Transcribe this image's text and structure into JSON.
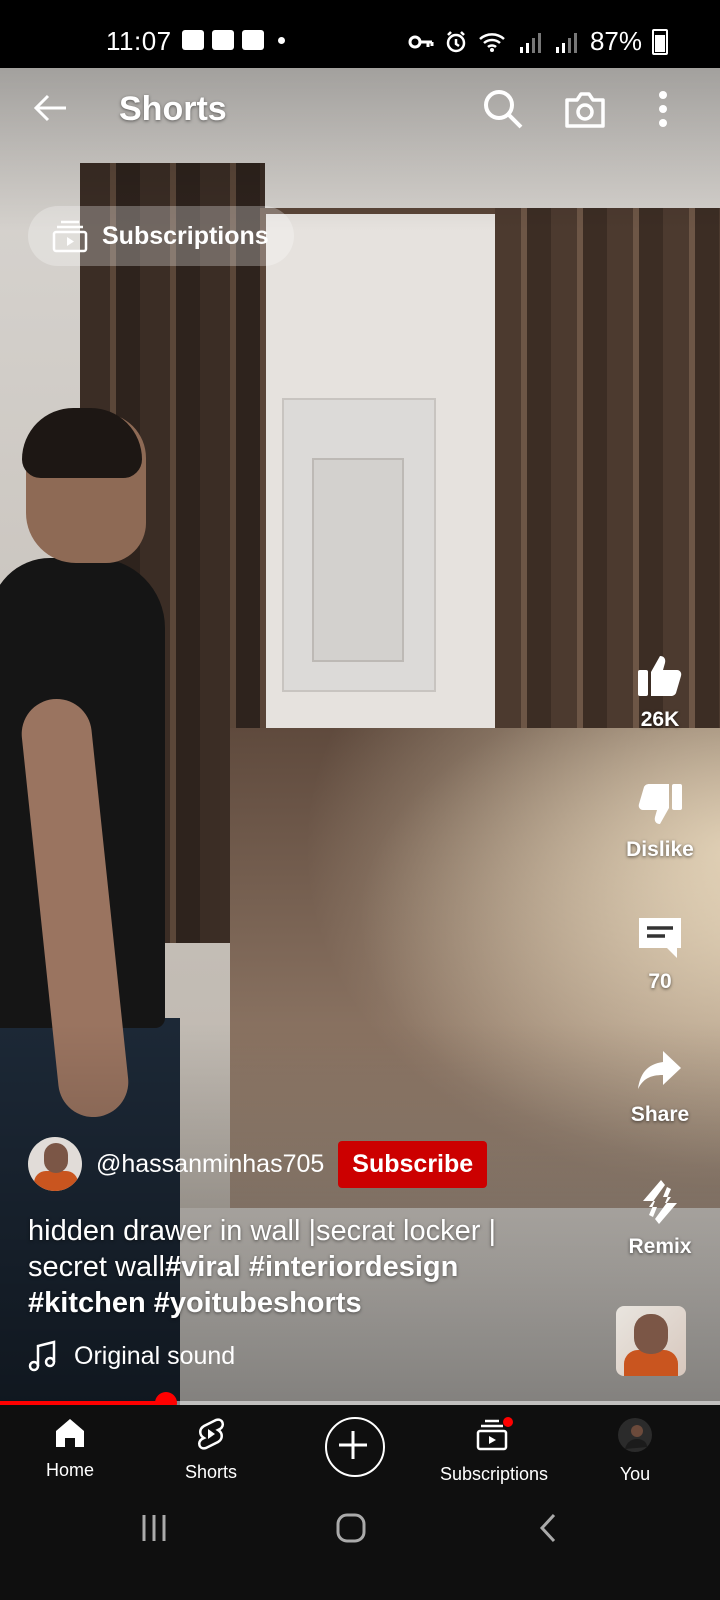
{
  "status_bar": {
    "time": "11:07",
    "battery": "87%"
  },
  "header": {
    "title": "Shorts",
    "icons": [
      "back-arrow-icon",
      "search-icon",
      "camera-icon",
      "more-vertical-icon"
    ]
  },
  "subscriptions_chip": {
    "label": "Subscriptions"
  },
  "actions": {
    "like_count": "26K",
    "dislike_label": "Dislike",
    "comments_count": "70",
    "share_label": "Share",
    "remix_label": "Remix"
  },
  "video": {
    "channel_handle": "@hassanminhas705",
    "subscribe_label": "Subscribe",
    "description_plain": "hidden drawer in wall |secrat locker | secret wall",
    "hashtags_line1": "#viral #interiordesign",
    "hashtags_line2": "#kitchen #yoitubeshorts",
    "sound_label": "Original sound",
    "progress": 0.23
  },
  "bottom_nav": {
    "home": "Home",
    "shorts": "Shorts",
    "subscriptions": "Subscriptions",
    "you": "You"
  },
  "colors": {
    "accent_red": "#ff0000",
    "subscribe_red": "#cc0000",
    "nav_bg": "#0f0f0f"
  }
}
